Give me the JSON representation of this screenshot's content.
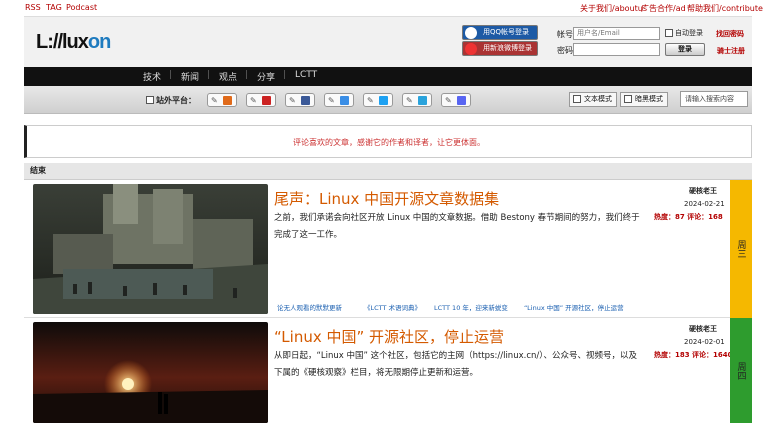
{
  "topbar": {
    "left": [
      "RSS",
      "TAG",
      "Podcast"
    ],
    "right": [
      "关于我们/aboutus",
      "广告合作/ad",
      "帮助我们/contribute"
    ]
  },
  "logo": {
    "text_a": "L:/",
    "text_b": "/lux",
    "text_c": "on"
  },
  "login": {
    "qq_label": "用QQ帐号登录",
    "weibo_label": "用新浪微博登录",
    "account_label": "帐号",
    "account_placeholder": "用户名/Email",
    "password_label": "密码",
    "auto_login": "自动登录",
    "login_button": "登录",
    "find_password": "找回密码",
    "register": "骑士注册"
  },
  "nav": {
    "items": [
      "技术",
      "新闻",
      "观点",
      "分享",
      "LCTT"
    ]
  },
  "sharebar": {
    "label": "站外平台：",
    "text_mode": "文本模式",
    "dark_mode": "暗黑模式",
    "search_placeholder": "请输入搜索内容"
  },
  "notice": {
    "text": "评论喜欢的文章，感谢它的作者和译者，让它更体面。"
  },
  "section": {
    "title": "结束"
  },
  "articles": [
    {
      "title": "尾声：Linux 中国开源文章数据集",
      "excerpt": "之前，我们承诺会向社区开放 Linux 中国的文章数据。借助 Bestony 春节期间的努力，我们终于完成了这一工作。",
      "author": "硬核老王",
      "date": "2024-02-21",
      "stats": "热度：87 评论：168",
      "day": "周三",
      "day_color": "#f5b800",
      "tags": [
        "论无人观看的默默更新",
        "《LCTT 术语词典》",
        "LCTT 10 年，迎来新蜕变",
        "“Linux 中国” 开源社区，停止运营"
      ]
    },
    {
      "title": "“Linux 中国” 开源社区，停止运营",
      "excerpt": "从即日起，“Linux 中国” 这个社区，包括它的主网（https://linux.cn/）、公众号、视频号，以及下属的《硬核观察》栏目，将无限期停止更新和运营。",
      "author": "硬核老王",
      "date": "2024-02-01",
      "stats": "热度：183 评论：1640",
      "day": "周四",
      "day_color": "#2e9c2e"
    }
  ]
}
